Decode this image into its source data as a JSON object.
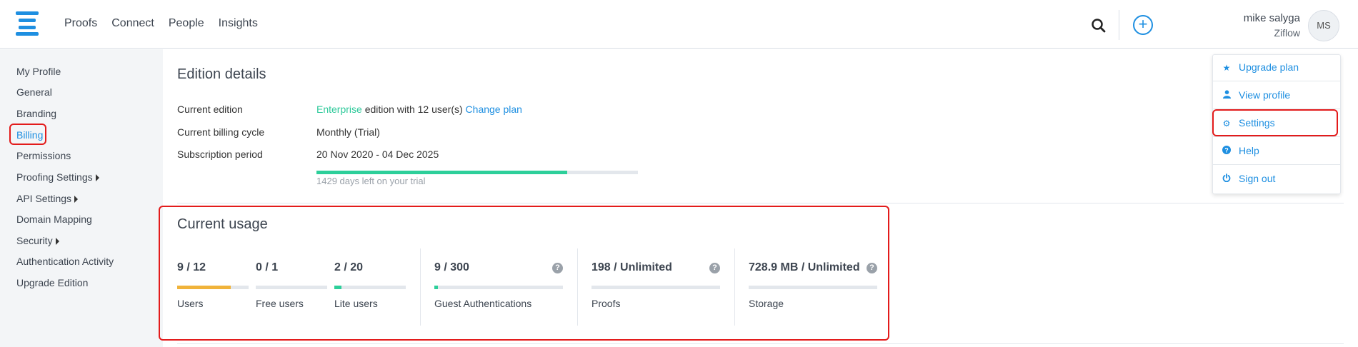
{
  "header": {
    "nav": [
      "Proofs",
      "Connect",
      "People",
      "Insights"
    ],
    "user_name": "mike salyga",
    "user_org": "Ziflow",
    "avatar_initials": "MS",
    "plus_symbol": "+"
  },
  "sidebar": {
    "items": [
      "My Profile",
      "General",
      "Branding",
      "Billing",
      "Permissions",
      "Proofing Settings",
      "API Settings",
      "Domain Mapping",
      "Security",
      "Authentication Activity",
      "Upgrade Edition"
    ],
    "active": "Billing"
  },
  "edition": {
    "title": "Edition details",
    "current_edition_label": "Current edition",
    "edition_name": "Enterprise",
    "edition_suffix": "edition with 12 user(s)",
    "change_plan": "Change plan",
    "billing_cycle_label": "Current billing cycle",
    "billing_cycle_value": "Monthly (Trial)",
    "subscription_label": "Subscription period",
    "subscription_value": "20 Nov 2020 - 04 Dec 2025",
    "trial_progress": 0.78,
    "trial_text": "1429 days left on your trial"
  },
  "usage": {
    "title": "Current usage",
    "metrics": [
      {
        "value": "9 / 12",
        "label": "Users",
        "progress": 0.75,
        "color": "#f0b33a"
      },
      {
        "value": "0 / 1",
        "label": "Free users",
        "progress": 0,
        "color": "#2dcf9a"
      },
      {
        "value": "2 / 20",
        "label": "Lite users",
        "progress": 0.1,
        "color": "#2dcf9a"
      },
      {
        "value": "9 / 300",
        "label": "Guest Authentications",
        "progress": 0.03,
        "color": "#2dcf9a"
      },
      {
        "value": "198 / Unlimited",
        "label": "Proofs",
        "progress": 0,
        "color": "#2dcf9a"
      },
      {
        "value": "728.9 MB / Unlimited",
        "label": "Storage",
        "progress": 0,
        "color": "#2dcf9a"
      }
    ],
    "help_glyph": "?"
  },
  "dropdown": {
    "items": [
      {
        "label": "Upgrade plan",
        "icon": "star-icon"
      },
      {
        "label": "View profile",
        "icon": "person-icon"
      },
      {
        "label": "Settings",
        "icon": "gear-icon"
      },
      {
        "label": "Help",
        "icon": "question-icon"
      },
      {
        "label": "Sign out",
        "icon": "power-icon"
      }
    ]
  },
  "colors": {
    "accent": "#1e8fe1",
    "green": "#2dcf9a",
    "highlight": "#e31b1b"
  }
}
